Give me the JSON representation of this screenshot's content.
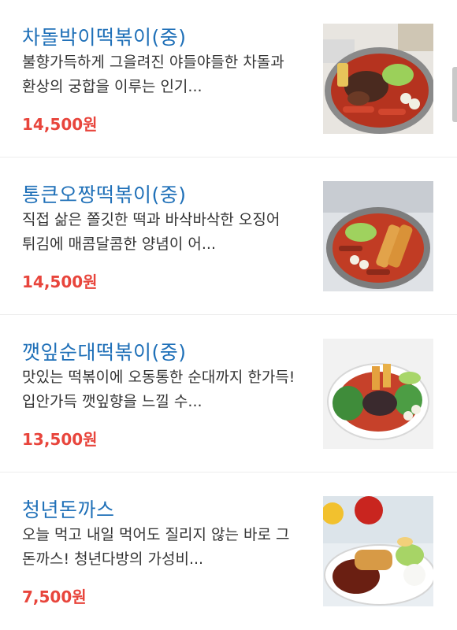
{
  "menu": {
    "items": [
      {
        "name": "차돌박이떡볶이(중)",
        "description": "불향가득하게 그을려진 야들야들한 차돌과 환상의 궁합을 이루는 인기...",
        "price": "14,500원",
        "image": "chadol-tteokbokki-photo"
      },
      {
        "name": "통큰오짱떡볶이(중)",
        "description": "직접 삶은 쫄깃한 떡과 바삭바삭한 오징어 튀김에 매콤달콤한 양념이 어...",
        "price": "14,500원",
        "image": "squid-tteokbokki-photo"
      },
      {
        "name": "깻잎순대떡볶이(중)",
        "description": "맛있는 떡볶이에 오동통한 순대까지 한가득! 입안가득 깻잎향을 느낄 수...",
        "price": "13,500원",
        "image": "perilla-sundae-tteokbokki-photo"
      },
      {
        "name": "청년돈까스",
        "description": "오늘 먹고 내일 먹어도 질리지 않는 바로 그 돈까스! 청년다방의 가성비...",
        "price": "7,500원",
        "image": "pork-cutlet-photo"
      }
    ]
  },
  "colors": {
    "name": "#1f70b8",
    "price": "#e8453c",
    "description": "#333333"
  }
}
